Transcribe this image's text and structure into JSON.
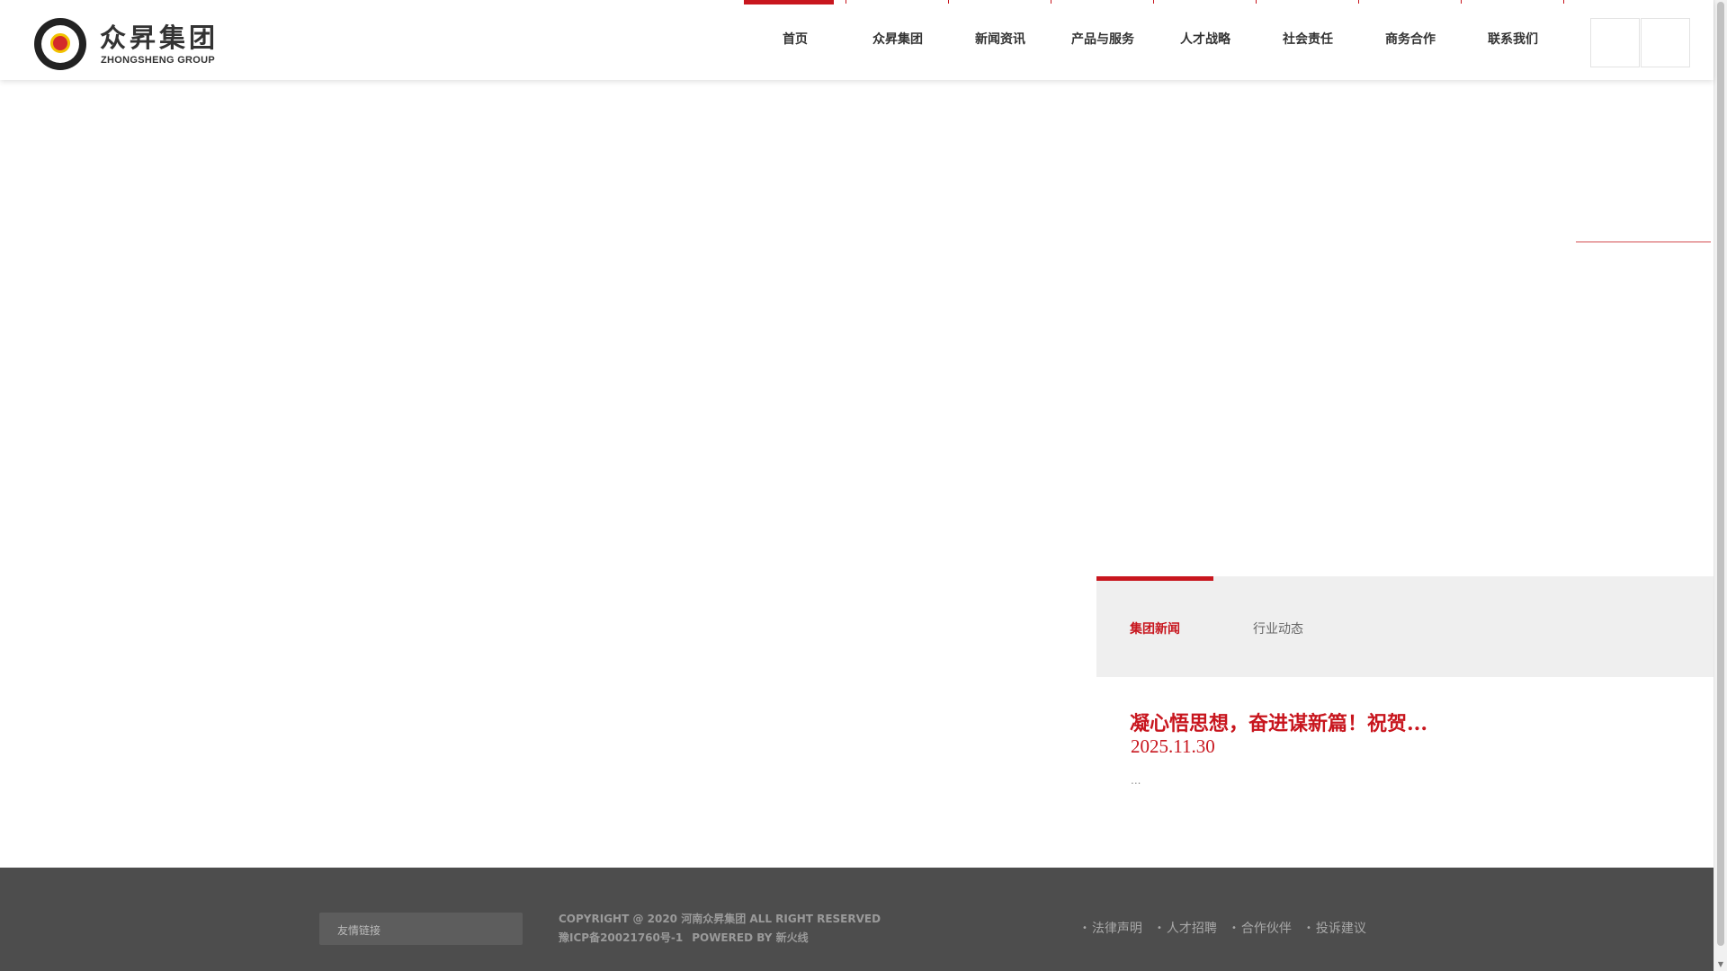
{
  "header": {
    "logo": {
      "cn": "众昇集团",
      "en": "ZHONGSHENG GROUP"
    },
    "nav": [
      {
        "label": "首页",
        "active": true
      },
      {
        "label": "众昇集团"
      },
      {
        "label": "新闻资讯"
      },
      {
        "label": "产品与服务"
      },
      {
        "label": "人才战略"
      },
      {
        "label": "社会责任"
      },
      {
        "label": "商务合作"
      },
      {
        "label": "联系我们"
      }
    ]
  },
  "colors": {
    "accent": "#c8161e",
    "footer_bg": "#4d4d4d",
    "tab_bg": "#efefef"
  },
  "news": {
    "tabs": [
      {
        "label": "集团新闻",
        "active": true
      },
      {
        "label": "行业动态"
      }
    ],
    "item": {
      "title": "凝心悟思想，奋进谋新篇！祝贺...",
      "date": "2025.11.30",
      "summary": "..."
    }
  },
  "footer": {
    "links_select": "友情链接",
    "copyright_line1": "COPYRIGHT @ 2020 河南众昇集团 ALL RIGHT RESERVED",
    "icp": "豫ICP备20021760号-1",
    "powered": "POWERED BY 新火线",
    "links": [
      "法律声明",
      "人才招聘",
      "合作伙伴",
      "投诉建议"
    ]
  }
}
